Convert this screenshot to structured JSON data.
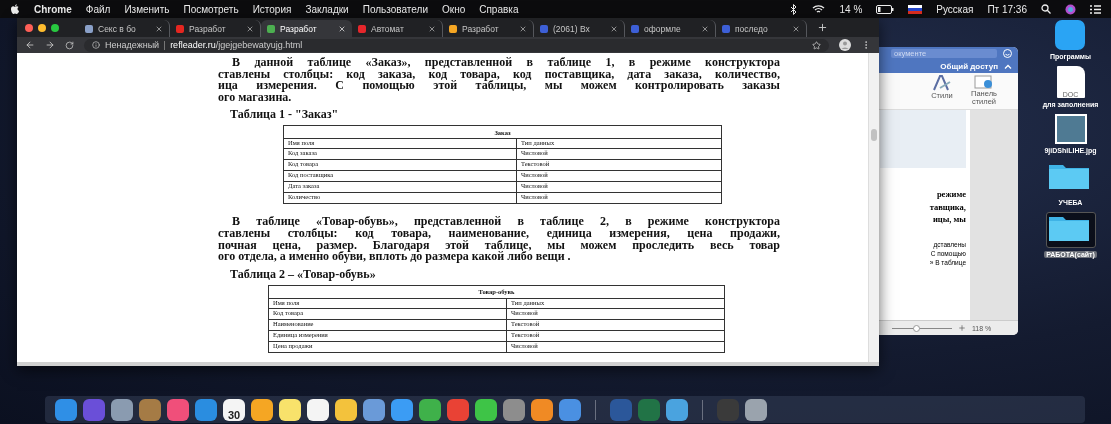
{
  "menu_bar": {
    "app": "Chrome",
    "items": [
      "Файл",
      "Изменить",
      "Посмотреть",
      "История",
      "Закладки",
      "Пользователи",
      "Окно",
      "Справка"
    ],
    "battery": "14 %",
    "input_source": "Русская",
    "clock": "Пт 17:36"
  },
  "browser": {
    "tabs": [
      {
        "title": "Секс в бо",
        "selected": false,
        "color": "#8aa0c8"
      },
      {
        "title": "Разработ",
        "selected": false,
        "color": "#e52620"
      },
      {
        "title": "Разработ",
        "selected": true,
        "color": "#4caf50"
      },
      {
        "title": "Автомат",
        "selected": false,
        "color": "#e5262b"
      },
      {
        "title": "Разработ",
        "selected": false,
        "color": "#f5a623"
      },
      {
        "title": "(2061) Вх",
        "selected": false,
        "color": "#3d5fd6"
      },
      {
        "title": "оформле",
        "selected": false,
        "color": "#3d5fd6"
      },
      {
        "title": "последо",
        "selected": false,
        "color": "#3d5fd6"
      }
    ],
    "address": {
      "security": "Ненадежный",
      "host": "refleader.ru",
      "path": "/jgejgebewatyujg.html"
    },
    "document": [
      {
        "paragraph": [
          "В данной таблице «Заказ», представленной в таблице 1, в режиме конструктора",
          "ставлены столбцы: код заказа, код товара, код поставщика, дата заказа, количество,",
          "ица измерения. С помощью этой таблицы,  мы можем контролировать заказы",
          "ого магазина."
        ],
        "caption": "Таблица 1 - \"Заказ\"",
        "table": {
          "title": "Заказ",
          "header": [
            "Имя поля",
            "Тип данных"
          ],
          "rows": [
            [
              "Код заказа",
              "Числовой"
            ],
            [
              "Код товара",
              "Текстовой"
            ],
            [
              "Код поставщика",
              "Числовой"
            ],
            [
              "Дата заказа",
              "Числовой"
            ],
            [
              "Количество",
              "Числовой"
            ]
          ]
        }
      },
      {
        "paragraph": [
          "В таблице «Товар-обувь», представленной в таблице 2, в режиме конструктора",
          "ставлены столбцы: код товара, наименование, единица измерения, цена продажи,",
          "почная цена, размер. Благодаря этой таблице,  мы можем проследить весь товар",
          "ого отдела, а именно обуви, вплоть до размера какой либо вещи ."
        ],
        "caption": "Таблица 2 – «Товар-обувь»",
        "table": {
          "title": "Товар-обувь",
          "header": [
            "Имя поля",
            "Тип данных"
          ],
          "rows": [
            [
              "Код товара",
              "Числовой"
            ],
            [
              "Наименование",
              "Текстовой"
            ],
            [
              "Единица измерения",
              "Текстовой"
            ],
            [
              "Цена продажи",
              "Числовой"
            ]
          ]
        }
      }
    ]
  },
  "word_window": {
    "search_placeholder": "окументе",
    "share": "Общий доступ",
    "ribbon": [
      "Стили",
      "Панель стилей"
    ],
    "text_lines": [
      "режиме",
      "тавщика,",
      "ицы,  мы"
    ],
    "small_lines": [
      "дставлены",
      "С помощью",
      "» В таблице"
    ],
    "zoom": "118 %",
    "zoom_slider": {
      "level": 0.4
    }
  },
  "desktop_icons": [
    {
      "label": "Программы",
      "kind": "app",
      "selected": false
    },
    {
      "label": "для заполнения",
      "kind": "doc",
      "badge": "DOC",
      "selected": false
    },
    {
      "label": "9jiDShiLIHE.jpg",
      "kind": "photo",
      "selected": false
    },
    {
      "label": "УЧЕБА",
      "kind": "folder",
      "selected": false
    },
    {
      "label": "РАБОТА(сайт)",
      "kind": "folder",
      "selected": true
    }
  ],
  "dock": [
    {
      "kind": "app",
      "color": "#2f8fe6"
    },
    {
      "kind": "app",
      "color": "#6a4fd8"
    },
    {
      "kind": "app",
      "color": "#8a9bb0"
    },
    {
      "kind": "app",
      "color": "#a57b45"
    },
    {
      "kind": "app",
      "color": "#f04f7a"
    },
    {
      "kind": "app",
      "color": "#2a8de0"
    },
    {
      "kind": "calendar",
      "color": "#f4f4f4",
      "text": "30"
    },
    {
      "kind": "app",
      "color": "#f5a623"
    },
    {
      "kind": "app",
      "color": "#f8e26b"
    },
    {
      "kind": "app",
      "color": "#f4f4f4"
    },
    {
      "kind": "app",
      "color": "#f3c23c"
    },
    {
      "kind": "app",
      "color": "#6a9ad8"
    },
    {
      "kind": "app",
      "color": "#3b9cf4"
    },
    {
      "kind": "app",
      "color": "#3fb14a"
    },
    {
      "kind": "app",
      "color": "#e94235"
    },
    {
      "kind": "app",
      "color": "#3ec447"
    },
    {
      "kind": "app",
      "color": "#8d8d8d"
    },
    {
      "kind": "app",
      "color": "#f08a24"
    },
    {
      "kind": "app",
      "color": "#4a90e2"
    },
    {
      "kind": "separator"
    },
    {
      "kind": "app",
      "color": "#2b579a"
    },
    {
      "kind": "app",
      "color": "#217346"
    },
    {
      "kind": "app",
      "color": "#4aa3df"
    },
    {
      "kind": "separator"
    },
    {
      "kind": "app",
      "color": "#3a3a3a"
    },
    {
      "kind": "app",
      "color": "#9aa3ad"
    }
  ]
}
